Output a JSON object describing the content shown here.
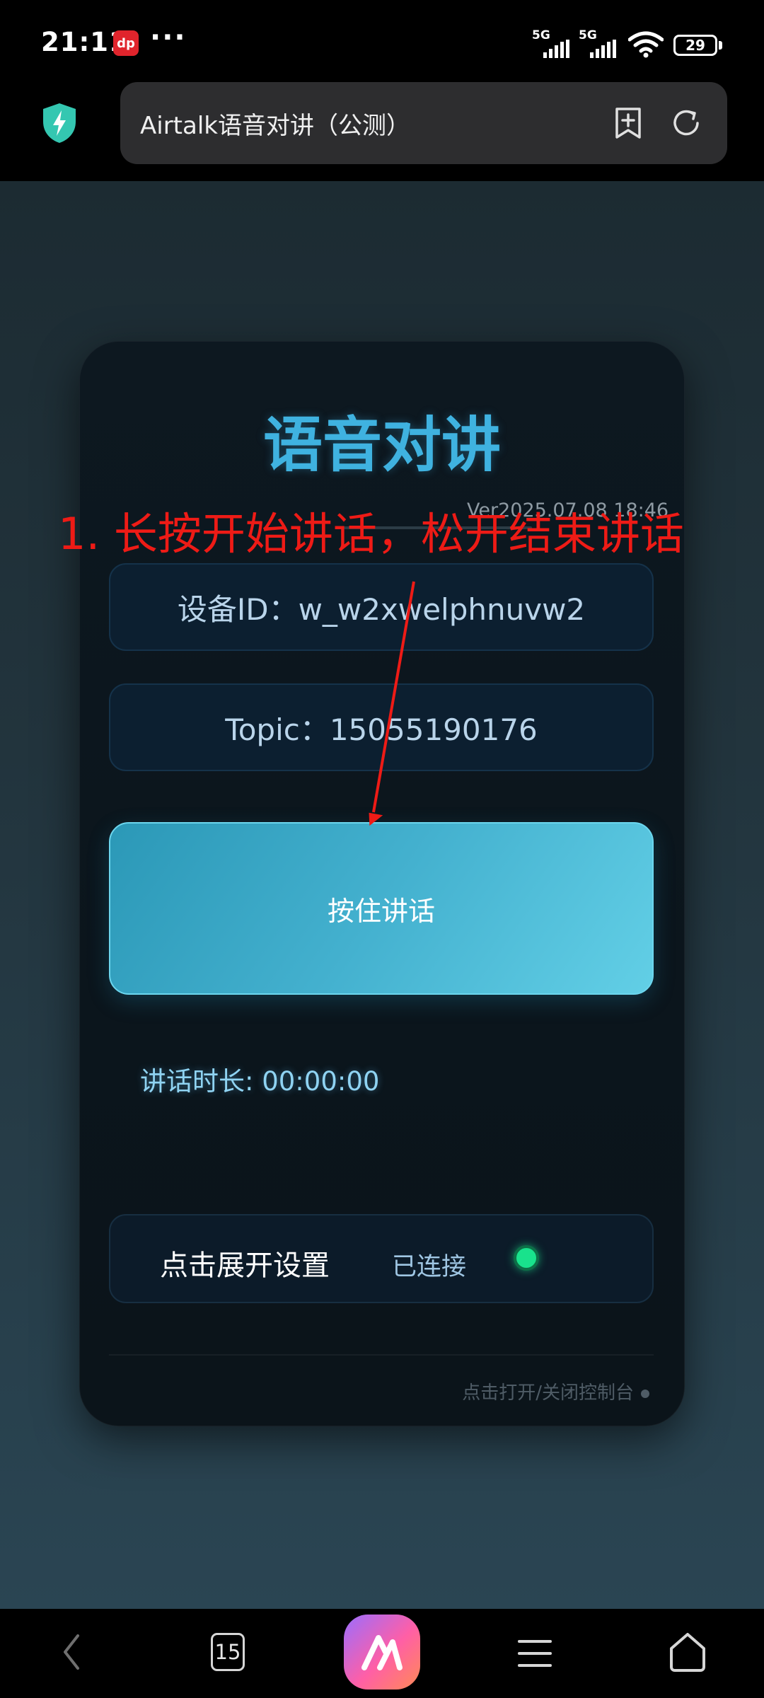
{
  "status_bar": {
    "time": "21:11",
    "notification_app_label": "dp",
    "more_indicator": "···",
    "signal_1_label": "5G",
    "signal_2_label": "5G",
    "battery_level": "29"
  },
  "browser": {
    "page_title": "Airtalk语音对讲（公测）",
    "icons": [
      "shield-bolt-icon",
      "add-bookmark-icon",
      "reload-icon"
    ]
  },
  "page": {
    "title": "语音对讲",
    "version": "Ver2025.07.08 18:46",
    "device_id_label": "设备ID：w_w2xwelphnuvw2",
    "topic_label": "Topic：15055190176",
    "talk_button_label": "按住讲话",
    "duration_label": "讲话时长: 00:00:00",
    "settings_label": "点击展开设置",
    "connection_status": "已连接",
    "console_toggle_label": "点击打开/关闭控制台"
  },
  "annotation": {
    "text": "1. 长按开始讲话，松开结束讲话",
    "color": "#ee1b16"
  },
  "nav": {
    "tabs_count": "15",
    "icons": [
      "back-icon",
      "tabs-icon",
      "ai-assistant-icon",
      "menu-icon",
      "home-icon"
    ]
  },
  "colors": {
    "accent": "#3fb2e0",
    "status_connected": "#19e28c"
  }
}
